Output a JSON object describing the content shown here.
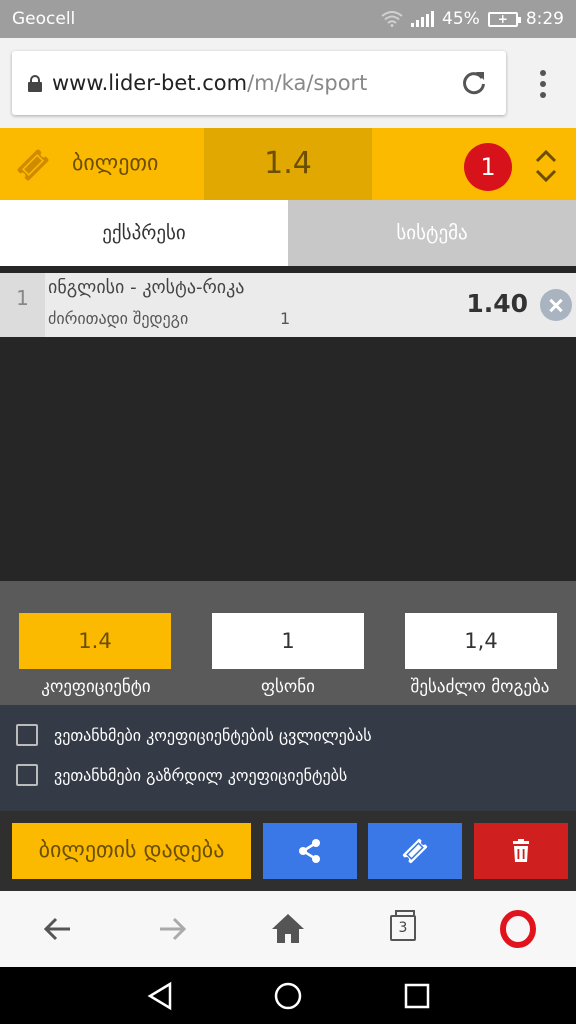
{
  "status_bar": {
    "carrier": "Geocell",
    "battery": "45%",
    "time": "8:29"
  },
  "browser": {
    "url_domain": "www.lider-bet.com",
    "url_path": "/m/ka/sport",
    "tabs_count": "3"
  },
  "ticket": {
    "label": "ბილეთი",
    "total_odds": "1.4",
    "count": "1"
  },
  "tabs": [
    {
      "label": "ექსპრესი",
      "active": true
    },
    {
      "label": "სისტემა",
      "active": false
    }
  ],
  "bets": [
    {
      "number": "1",
      "event": "ინგლისი - კოსტა-რიკა",
      "market": "ძირითადი შედეგი",
      "pick": "1",
      "odd": "1.40"
    }
  ],
  "summary": {
    "odds": {
      "value": "1.4",
      "label": "კოეფიციენტი"
    },
    "stake": {
      "value": "1",
      "label": "ფსონი"
    },
    "win": {
      "value": "1,4",
      "label": "შესაძლო მოგება"
    }
  },
  "options": [
    {
      "label": "ვეთანხმები კოეფიციენტების ცვლილებას"
    },
    {
      "label": "ვეთანხმები გაზრდილ კოეფიციენტებს"
    }
  ],
  "actions": {
    "place_label": "ბილეთის დადება"
  },
  "colors": {
    "accent": "#fbb900",
    "accent_dark": "#e0a800",
    "blue": "#3b78e7",
    "red": "#cf1f1f",
    "badge": "#d8121b"
  }
}
